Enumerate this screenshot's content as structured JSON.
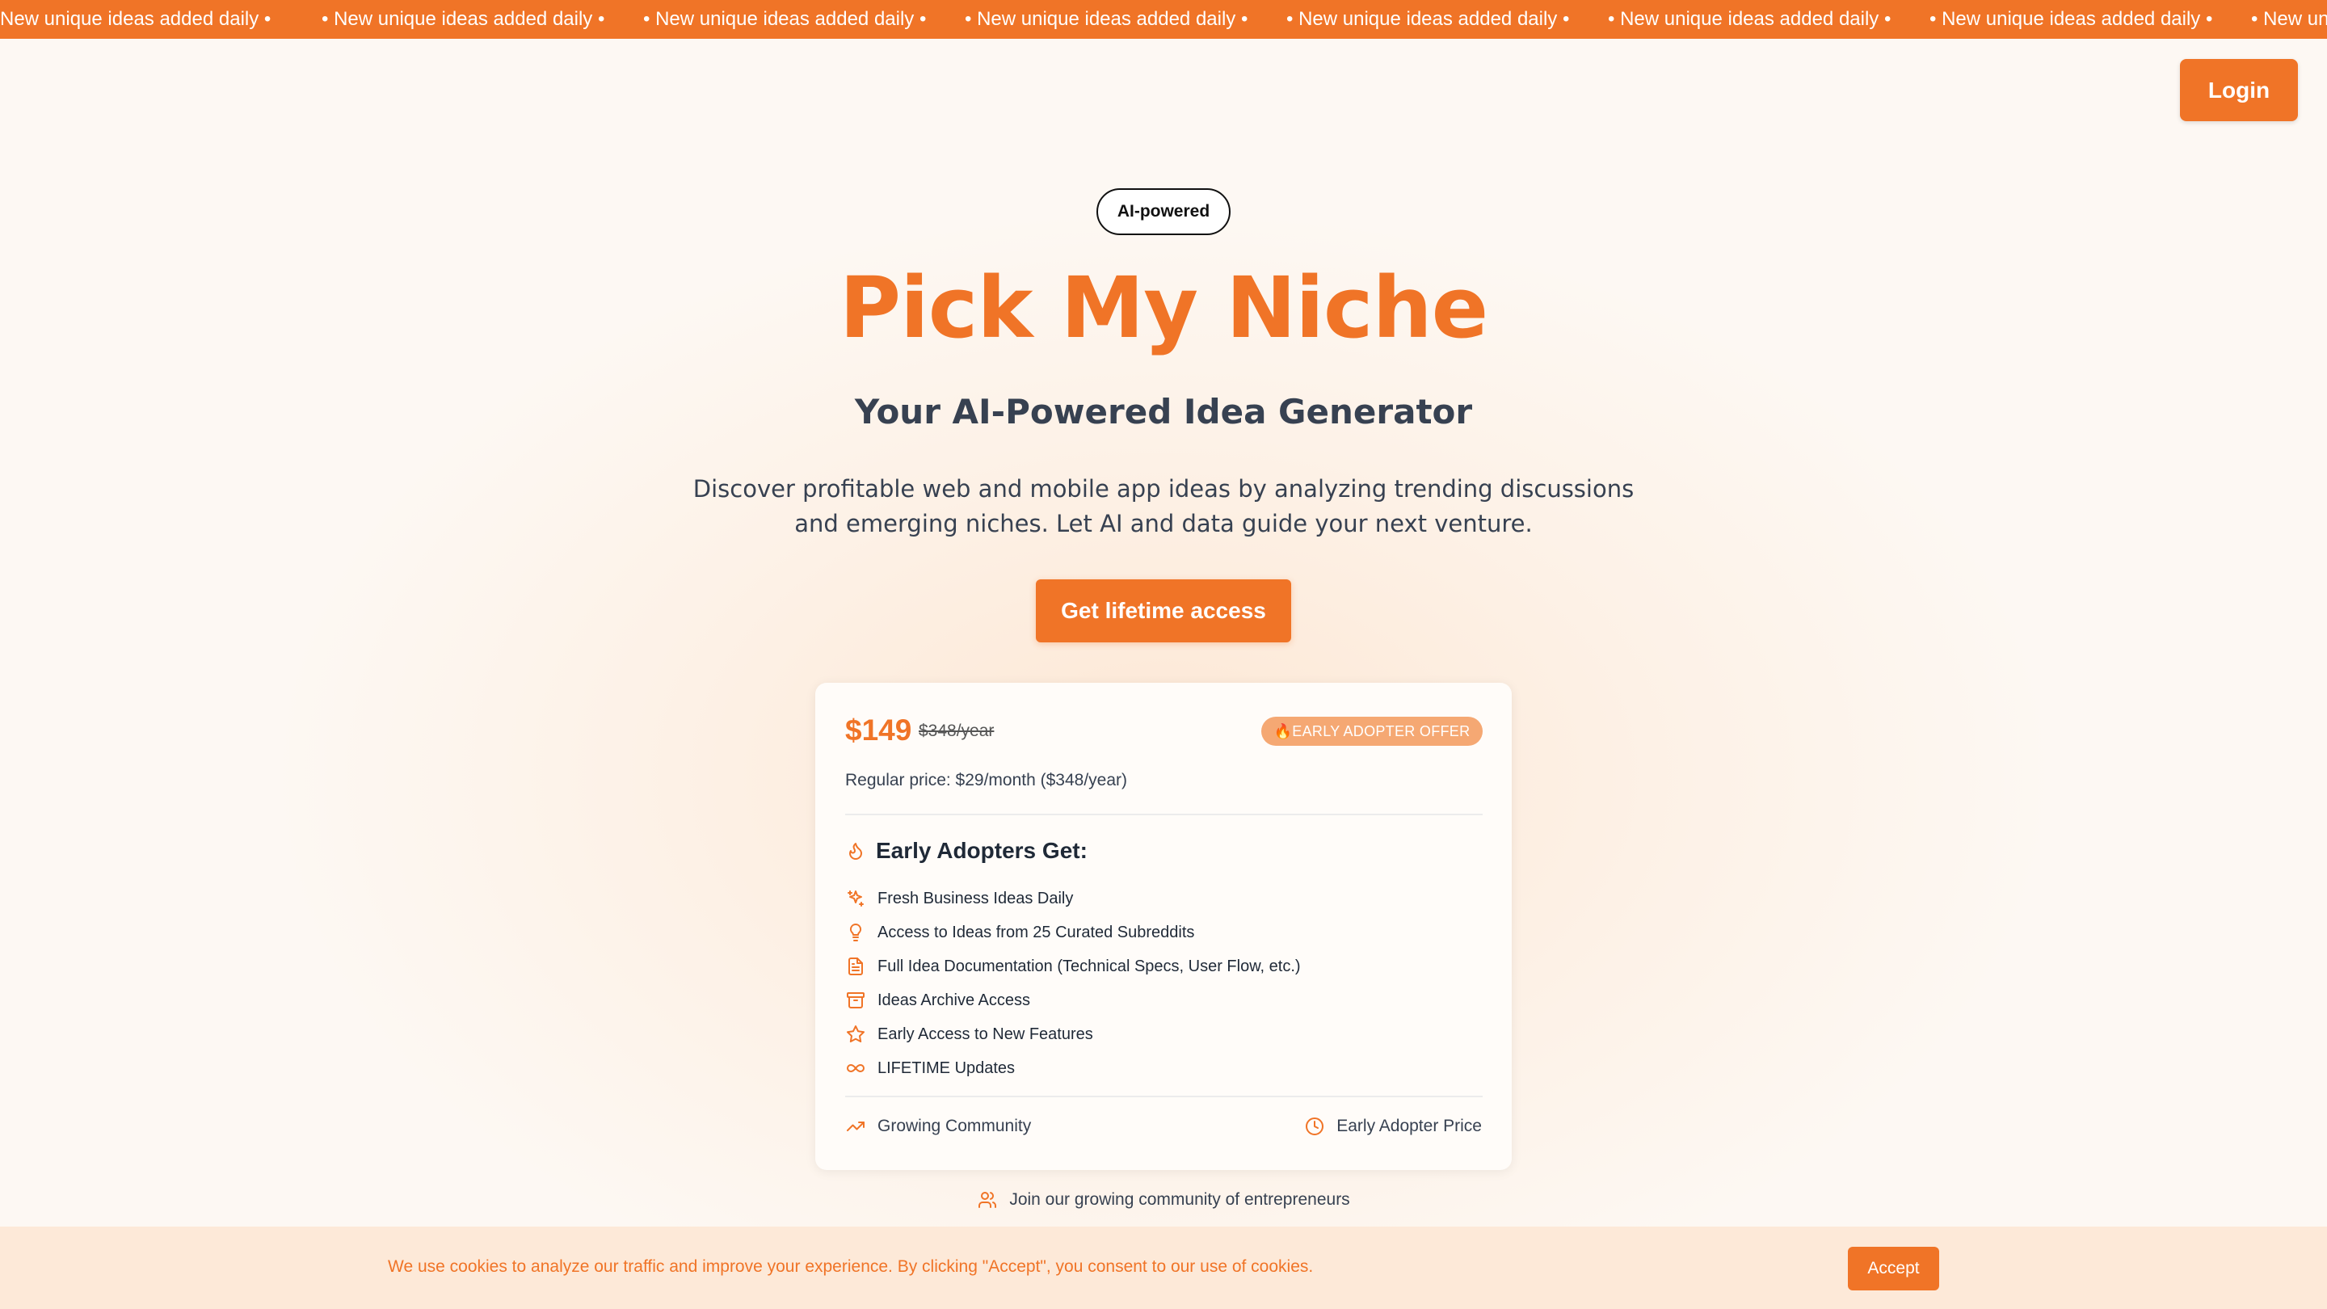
{
  "marquee": {
    "items": [
      "New unique ideas added daily •",
      "• New unique ideas added daily •",
      "• New unique ideas added daily •",
      "• New unique ideas added daily •",
      "• New unique ideas added daily •",
      "• New unique ideas added daily •",
      "• New unique ideas added daily •",
      "• New unique ideas added daily •"
    ]
  },
  "header": {
    "login_label": "Login"
  },
  "hero": {
    "badge": "AI-powered",
    "title": "Pick My Niche",
    "subtitle": "Your AI-Powered Idea Generator",
    "description": "Discover profitable web and mobile app ideas by analyzing trending discussions and emerging niches. Let AI and data guide your next venture.",
    "cta_label": "Get lifetime access"
  },
  "pricing": {
    "price": "$149",
    "old_price": "$348/year",
    "offer_badge": "🔥EARLY ADOPTER OFFER",
    "regular_price": "Regular price: $29/month ($348/year)",
    "section_title": "Early Adopters Get:",
    "features": [
      {
        "icon": "sparkles-icon",
        "label": "Fresh Business Ideas Daily"
      },
      {
        "icon": "lightbulb-icon",
        "label": "Access to Ideas from 25 Curated Subreddits"
      },
      {
        "icon": "document-icon",
        "label": "Full Idea Documentation (Technical Specs, User Flow, etc.)"
      },
      {
        "icon": "archive-icon",
        "label": "Ideas Archive Access"
      },
      {
        "icon": "star-icon",
        "label": "Early Access to New Features"
      },
      {
        "icon": "infinity-icon",
        "label": "LIFETIME Updates"
      }
    ],
    "footer_left": "Growing Community",
    "footer_right": "Early Adopter Price"
  },
  "community": {
    "text": "Join our growing community of entrepreneurs"
  },
  "cookie": {
    "text": "We use cookies to analyze our traffic and improve your experience. By clicking \"Accept\", you consent to our use of cookies.",
    "accept_label": "Accept"
  },
  "colors": {
    "accent": "#f07427",
    "badge_light": "#f5a873",
    "cookie_bg": "#fde9d8"
  }
}
